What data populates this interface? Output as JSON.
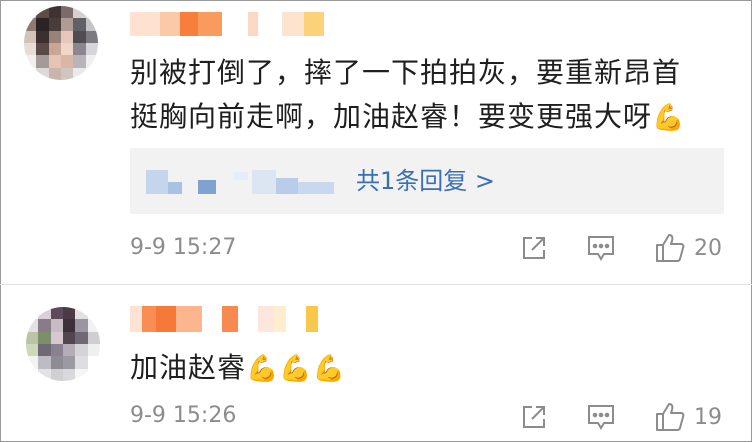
{
  "comments": [
    {
      "text_line1": "别被打倒了，摔了一下拍拍灰，要重新昂首",
      "text_line2": "挺胸向前走啊，加油赵睿！要变更强大呀",
      "emoji": "💪",
      "reply_link": "共1条回复 >",
      "timestamp": "9-9 15:27",
      "like_count": "20"
    },
    {
      "text": "加油赵睿",
      "emojis": "💪💪💪",
      "timestamp": "9-9 15:26",
      "like_count": "19"
    }
  ],
  "colors": {
    "link": "#3a6fb5",
    "meta": "#8c8c8c",
    "reply_bg": "#f2f2f2"
  },
  "icons": [
    "share-icon",
    "comment-icon",
    "like-icon"
  ]
}
